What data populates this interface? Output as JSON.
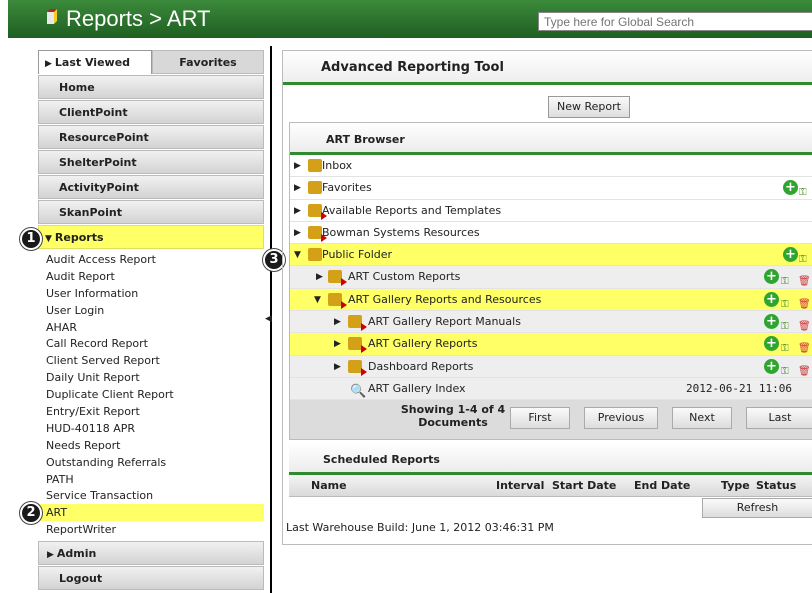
{
  "header": {
    "title": "Reports > ART",
    "search_placeholder": "Type here for Global Search"
  },
  "sidebar": {
    "tabs": [
      {
        "label": "Last Viewed"
      },
      {
        "label": "Favorites"
      }
    ],
    "nav_top": [
      {
        "label": "Home"
      },
      {
        "label": "ClientPoint"
      },
      {
        "label": "ResourcePoint"
      },
      {
        "label": "ShelterPoint"
      },
      {
        "label": "ActivityPoint"
      },
      {
        "label": "SkanPoint"
      }
    ],
    "reports_section": "Reports",
    "reports": [
      "Audit Access Report",
      "Audit Report",
      "User Information",
      "User Login",
      "AHAR",
      "Call Record Report",
      "Client Served Report",
      "Daily Unit Report",
      "Duplicate Client Report",
      "Entry/Exit Report",
      "HUD-40118 APR",
      "Needs Report",
      "Outstanding Referrals",
      "PATH",
      "Service Transaction",
      "ART",
      "ReportWriter"
    ],
    "selected_report": "ART",
    "admin": "Admin",
    "logout": "Logout"
  },
  "badges": [
    "1",
    "2",
    "3"
  ],
  "main": {
    "title": "Advanced Reporting Tool",
    "new_report": "New Report",
    "browser_title": "ART Browser",
    "rows": [
      {
        "label": "Inbox",
        "highlight": false,
        "level": 0
      },
      {
        "label": "Favorites",
        "highlight": false,
        "level": 0
      },
      {
        "label": "Available Reports and Templates",
        "highlight": false,
        "level": 0
      },
      {
        "label": "Bowman Systems Resources",
        "highlight": false,
        "level": 0
      },
      {
        "label": "Public Folder",
        "highlight": true,
        "level": 0
      },
      {
        "label": "ART Custom Reports",
        "highlight": false,
        "level": 1
      },
      {
        "label": "ART Gallery Reports and Resources",
        "highlight": true,
        "level": 1
      },
      {
        "label": "ART Gallery Report Manuals",
        "highlight": false,
        "level": 2
      },
      {
        "label": "ART Gallery Reports",
        "highlight": true,
        "level": 2
      },
      {
        "label": "Dashboard Reports",
        "highlight": false,
        "level": 2
      },
      {
        "label": "ART Gallery Index",
        "highlight": false,
        "level": 2,
        "date": "2012-06-21 11:06"
      }
    ],
    "pager": {
      "text": "Showing 1-4 of 4 Documents",
      "first": "First",
      "previous": "Previous",
      "next": "Next",
      "last": "Last"
    },
    "scheduled": {
      "title": "Scheduled Reports",
      "columns": [
        "Name",
        "Interval",
        "Start Date",
        "End Date",
        "Type",
        "Status"
      ],
      "refresh": "Refresh"
    },
    "warehouse": "Last Warehouse Build: June 1, 2012 03:46:31 PM"
  },
  "colors": {
    "header_green": "#2e7d32",
    "highlight_yellow": "#ffff66",
    "accent_green": "#2e8b2e"
  }
}
